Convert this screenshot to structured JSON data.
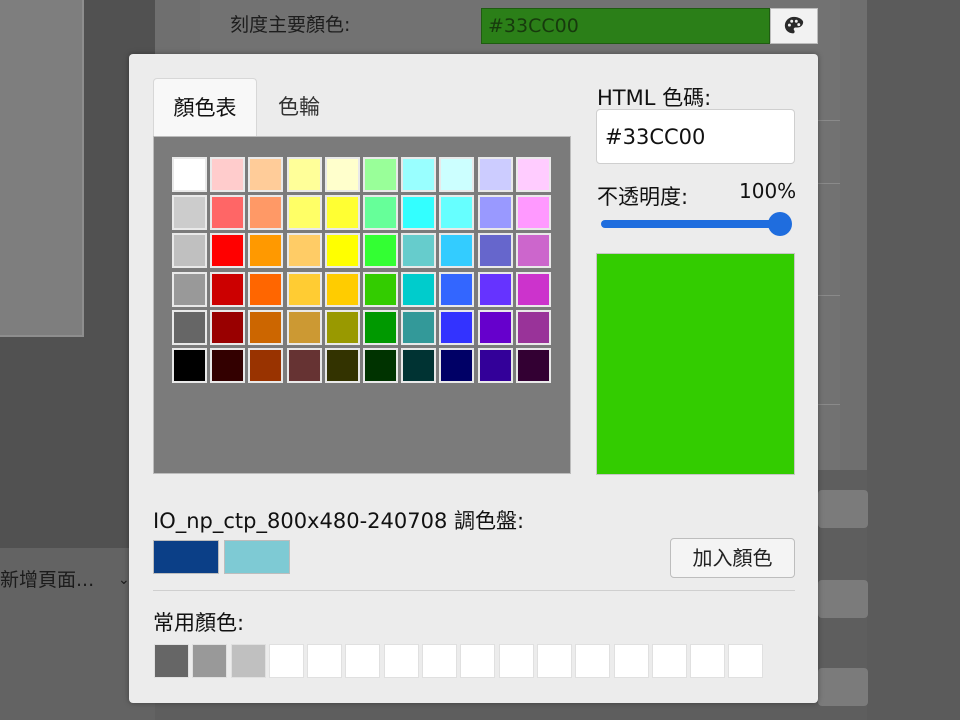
{
  "background": {
    "field_label": "刻度主要顏色:",
    "field_value": "#33CC00",
    "field_color": "#2b7f18",
    "palette_button_icon": "palette-icon",
    "left_menu_item": "新增頁面...",
    "left_menu_icon": "chevron-down-icon"
  },
  "dialog": {
    "tabs": [
      {
        "label": "顏色表",
        "active": true
      },
      {
        "label": "色輪",
        "active": false
      }
    ],
    "swatch_grid": [
      [
        "#FFFFFF",
        "#FFCCCC",
        "#FFCC99",
        "#FFFF99",
        "#FFFFCC",
        "#99FF99",
        "#99FFFF",
        "#CCFFFF",
        "#CCCCFF",
        "#FFCCFF"
      ],
      [
        "#CCCCCC",
        "#FF6666",
        "#FF9966",
        "#FFFF66",
        "#FFFF33",
        "#66FF99",
        "#33FFFF",
        "#66FFFF",
        "#9999FF",
        "#FF99FF"
      ],
      [
        "#C0C0C0",
        "#FF0000",
        "#FF9900",
        "#FFCC66",
        "#FFFF00",
        "#33FF33",
        "#66CCCC",
        "#33CCFF",
        "#6666CC",
        "#CC66CC"
      ],
      [
        "#999999",
        "#CC0000",
        "#FF6600",
        "#FFCC33",
        "#FFCC00",
        "#33CC00",
        "#00CCCC",
        "#3366FF",
        "#6633FF",
        "#CC33CC"
      ],
      [
        "#666666",
        "#990000",
        "#CC6600",
        "#CC9933",
        "#999900",
        "#009900",
        "#339999",
        "#3333FF",
        "#6600CC",
        "#993399"
      ],
      [
        "#000000",
        "#330000",
        "#993300",
        "#663333",
        "#333300",
        "#003300",
        "#003333",
        "#000066",
        "#330099",
        "#330033"
      ]
    ],
    "html_code_label": "HTML 色碼:",
    "html_code_value": "#33CC00",
    "opacity_label": "不透明度:",
    "opacity_value": "100%",
    "opacity_fraction": 1.0,
    "preview_color": "#33CC00",
    "palette_title": "IO_np_ctp_800x480-240708 調色盤:",
    "palette_colors": [
      "#0B3F87",
      "#7ECAD4"
    ],
    "add_color_label": "加入顏色",
    "common_colors_title": "常用顏色:",
    "common_colors": [
      "#666666",
      "#999999",
      "#C0C0C0",
      "#FFFFFF",
      "#FFFFFF",
      "#FFFFFF",
      "#FFFFFF",
      "#FFFFFF",
      "#FFFFFF",
      "#FFFFFF",
      "#FFFFFF",
      "#FFFFFF",
      "#FFFFFF",
      "#FFFFFF",
      "#FFFFFF",
      "#FFFFFF"
    ],
    "accent_color": "#1F6DDE"
  }
}
